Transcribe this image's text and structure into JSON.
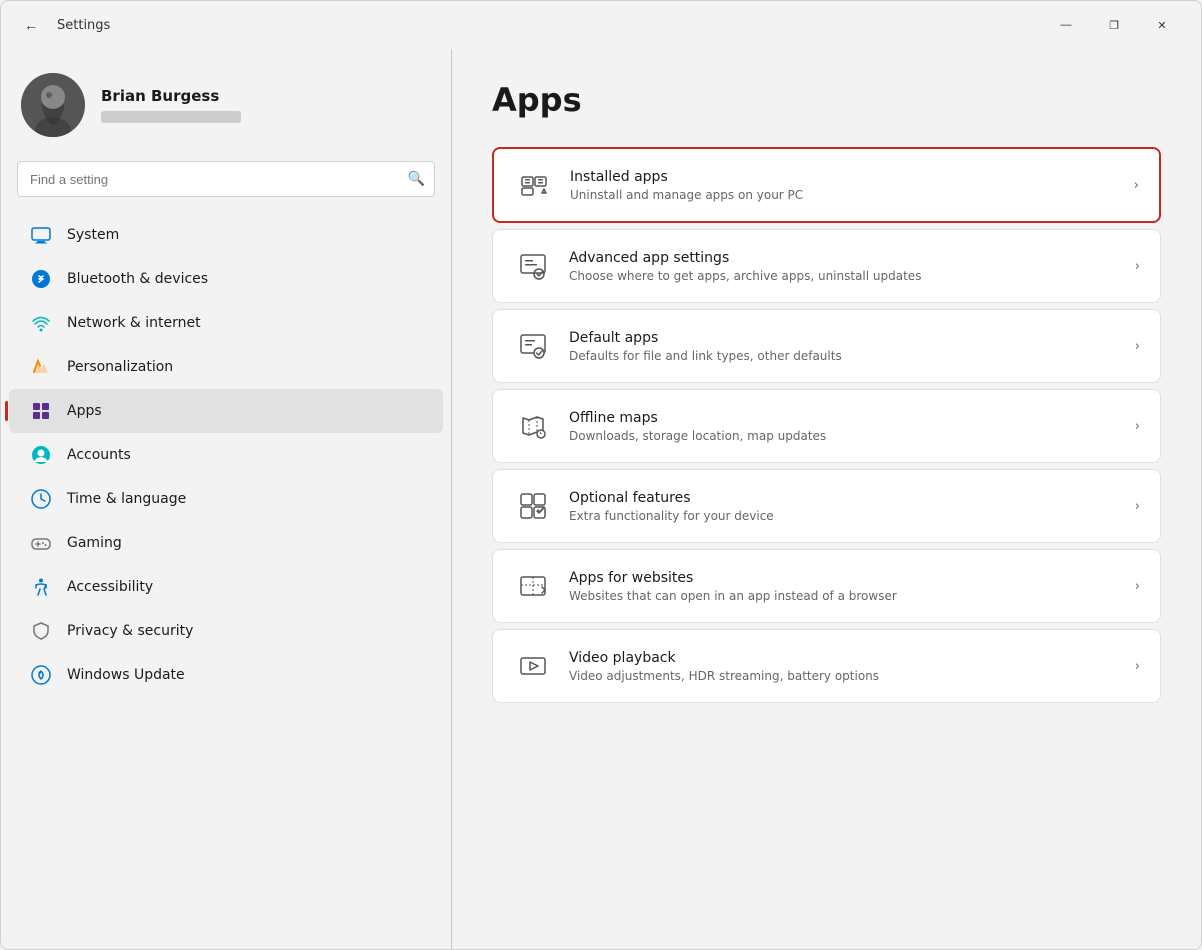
{
  "window": {
    "title": "Settings",
    "controls": {
      "minimize": "—",
      "maximize": "❐",
      "close": "✕"
    }
  },
  "user": {
    "name": "Brian Burgess"
  },
  "search": {
    "placeholder": "Find a setting"
  },
  "nav": {
    "items": [
      {
        "id": "system",
        "label": "System",
        "icon": "system"
      },
      {
        "id": "bluetooth",
        "label": "Bluetooth & devices",
        "icon": "bluetooth"
      },
      {
        "id": "network",
        "label": "Network & internet",
        "icon": "network"
      },
      {
        "id": "personalization",
        "label": "Personalization",
        "icon": "paint"
      },
      {
        "id": "apps",
        "label": "Apps",
        "icon": "apps",
        "active": true
      },
      {
        "id": "accounts",
        "label": "Accounts",
        "icon": "accounts"
      },
      {
        "id": "time",
        "label": "Time & language",
        "icon": "clock"
      },
      {
        "id": "gaming",
        "label": "Gaming",
        "icon": "gaming"
      },
      {
        "id": "accessibility",
        "label": "Accessibility",
        "icon": "accessibility"
      },
      {
        "id": "privacy",
        "label": "Privacy & security",
        "icon": "privacy"
      },
      {
        "id": "windows-update",
        "label": "Windows Update",
        "icon": "update"
      }
    ]
  },
  "content": {
    "page_title": "Apps",
    "cards": [
      {
        "id": "installed-apps",
        "title": "Installed apps",
        "subtitle": "Uninstall and manage apps on your PC",
        "highlighted": true
      },
      {
        "id": "advanced-app-settings",
        "title": "Advanced app settings",
        "subtitle": "Choose where to get apps, archive apps, uninstall updates",
        "highlighted": false
      },
      {
        "id": "default-apps",
        "title": "Default apps",
        "subtitle": "Defaults for file and link types, other defaults",
        "highlighted": false
      },
      {
        "id": "offline-maps",
        "title": "Offline maps",
        "subtitle": "Downloads, storage location, map updates",
        "highlighted": false
      },
      {
        "id": "optional-features",
        "title": "Optional features",
        "subtitle": "Extra functionality for your device",
        "highlighted": false
      },
      {
        "id": "apps-for-websites",
        "title": "Apps for websites",
        "subtitle": "Websites that can open in an app instead of a browser",
        "highlighted": false
      },
      {
        "id": "video-playback",
        "title": "Video playback",
        "subtitle": "Video adjustments, HDR streaming, battery options",
        "highlighted": false
      }
    ]
  }
}
